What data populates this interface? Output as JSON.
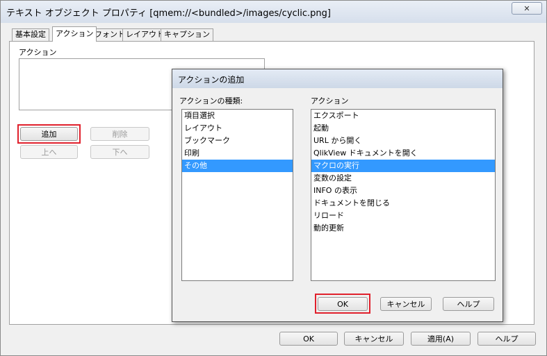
{
  "window": {
    "title": "テキスト オブジェクト プロパティ [qmem://<bundled>/images/cyclic.png]",
    "close_glyph": "✕"
  },
  "tabs": [
    {
      "label": "基本設定"
    },
    {
      "label": "アクション"
    },
    {
      "label": "フォント"
    },
    {
      "label": "レイアウト"
    },
    {
      "label": "キャプション"
    }
  ],
  "actions_panel": {
    "group_label": "アクション",
    "add_label": "追加",
    "delete_label": "削除",
    "up_label": "上へ",
    "down_label": "下へ"
  },
  "footer": {
    "ok_label": "OK",
    "cancel_label": "キャンセル",
    "apply_label": "適用(A)",
    "help_label": "ヘルプ"
  },
  "dialog": {
    "title": "アクションの追加",
    "type_label": "アクションの種類:",
    "action_label": "アクション",
    "types": [
      {
        "label": "項目選択"
      },
      {
        "label": "レイアウト"
      },
      {
        "label": "ブックマーク"
      },
      {
        "label": "印刷"
      },
      {
        "label": "その他"
      }
    ],
    "selected_type": "その他",
    "actions": [
      {
        "label": "エクスポート"
      },
      {
        "label": "起動"
      },
      {
        "label": "URL から開く"
      },
      {
        "label": "QlikView ドキュメントを開く"
      },
      {
        "label": "マクロの実行"
      },
      {
        "label": "変数の設定"
      },
      {
        "label": "INFO の表示"
      },
      {
        "label": "ドキュメントを閉じる"
      },
      {
        "label": "リロード"
      },
      {
        "label": "動的更新"
      }
    ],
    "selected_action": "マクロの実行",
    "ok_label": "OK",
    "cancel_label": "キャンセル",
    "help_label": "ヘルプ"
  },
  "colors": {
    "selection": "#3399ff",
    "highlight_box": "#e0202c"
  }
}
